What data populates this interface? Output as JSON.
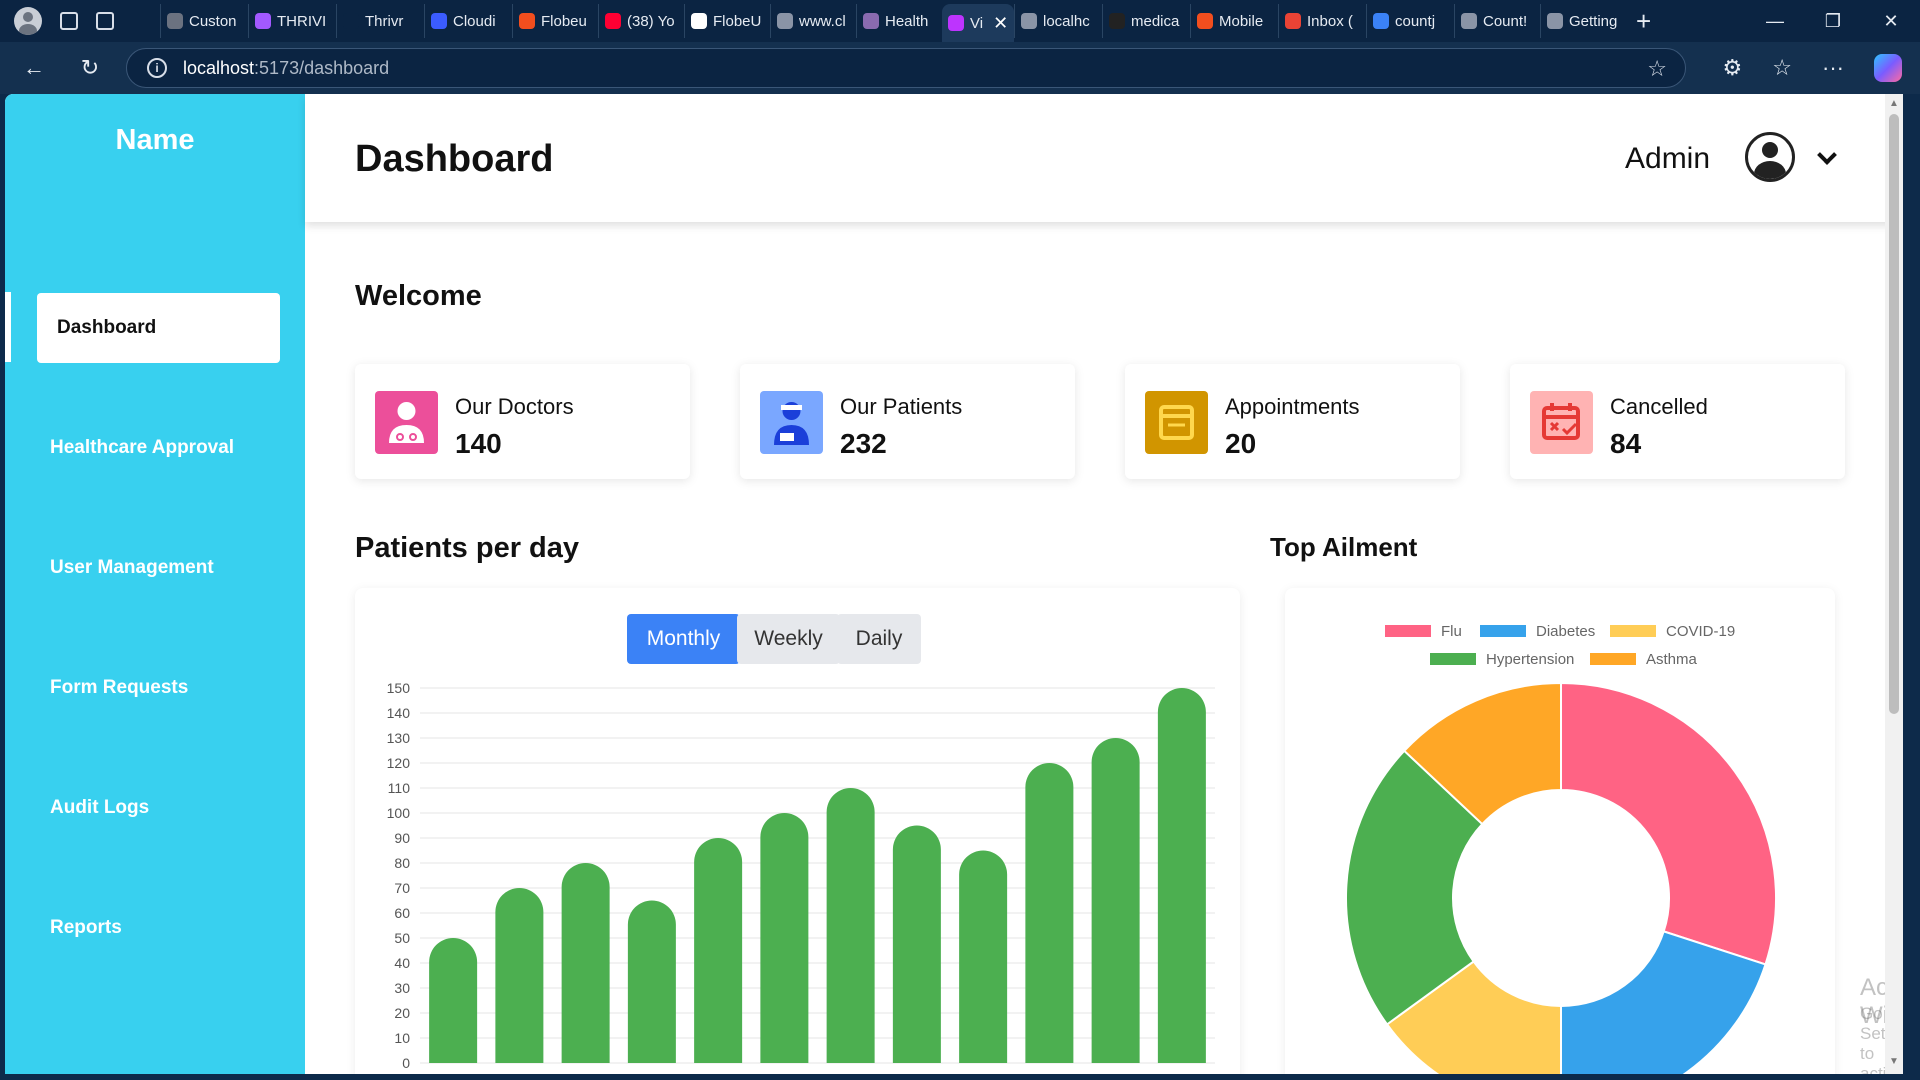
{
  "browser": {
    "tabs": [
      {
        "label": "Custon",
        "color": "#6b7280"
      },
      {
        "label": "THRIVI",
        "color": "#a259ff"
      },
      {
        "label": "Thrivr",
        "color": "#0b2442"
      },
      {
        "label": "Cloudi",
        "color": "#3b5cff"
      },
      {
        "label": "Flobeu",
        "color": "#f24e1e"
      },
      {
        "label": "(38) Yo",
        "color": "#ff0033"
      },
      {
        "label": "FlobeU",
        "color": "#ffffff"
      },
      {
        "label": "www.cl",
        "color": "#8a94a6"
      },
      {
        "label": "Health",
        "color": "#8a6bb0"
      },
      {
        "label": "Vi",
        "color": "#bd34fe",
        "active": true
      },
      {
        "label": "localhc",
        "color": "#8a94a6"
      },
      {
        "label": "medica",
        "color": "#222222"
      },
      {
        "label": "Mobile",
        "color": "#f24e1e"
      },
      {
        "label": "Inbox (",
        "color": "#ea4335"
      },
      {
        "label": "countj",
        "color": "#3b82f6"
      },
      {
        "label": "Count!",
        "color": "#8a94a6"
      },
      {
        "label": "Getting",
        "color": "#8a94a6"
      }
    ],
    "url_host": "localhost",
    "url_path": ":5173/dashboard"
  },
  "sidebar": {
    "brand": "Name",
    "items": [
      {
        "label": "Dashboard",
        "active": true
      },
      {
        "label": "Healthcare Approval"
      },
      {
        "label": "User Management"
      },
      {
        "label": "Form Requests"
      },
      {
        "label": "Audit Logs"
      },
      {
        "label": "Reports"
      }
    ]
  },
  "header": {
    "title": "Dashboard",
    "user": "Admin"
  },
  "welcome": "Welcome",
  "stats": [
    {
      "label": "Our Doctors",
      "value": "140",
      "icon": "doctor-icon",
      "bg": "#ec4f9a"
    },
    {
      "label": "Our Patients",
      "value": "232",
      "icon": "patient-icon",
      "bg": "#7aa7ff"
    },
    {
      "label": "Appointments",
      "value": "20",
      "icon": "calendar-box-icon",
      "bg": "#d19500"
    },
    {
      "label": "Cancelled",
      "value": "84",
      "icon": "calendar-cancel-icon",
      "bg": "#ffb3b3"
    }
  ],
  "patients_section": {
    "title": "Patients per day",
    "buttons": [
      "Monthly",
      "Weekly",
      "Daily"
    ],
    "active_button": "Monthly"
  },
  "ailment_section": {
    "title": "Top Ailment"
  },
  "watermark": {
    "line1": "Activate Windows",
    "line2": "Go to Settings to activate Windows."
  },
  "chart_data": [
    {
      "type": "bar",
      "categories": [
        "",
        "",
        "",
        "",
        "",
        "",
        "",
        "",
        "",
        "",
        "",
        ""
      ],
      "values": [
        50,
        70,
        80,
        65,
        90,
        100,
        110,
        95,
        85,
        120,
        130,
        150
      ],
      "ylim": [
        0,
        150
      ],
      "ytick_step": 10,
      "grid": true,
      "color": "#4caf50"
    },
    {
      "type": "pie",
      "donut": true,
      "labels": [
        "Flu",
        "Diabetes",
        "COVID-19",
        "Hypertension",
        "Asthma"
      ],
      "values": [
        30,
        20,
        15,
        22,
        13
      ],
      "colors": [
        "#ff6384",
        "#36a2eb",
        "#ffcd56",
        "#4caf50",
        "#ffa726"
      ],
      "legend": "top"
    }
  ]
}
